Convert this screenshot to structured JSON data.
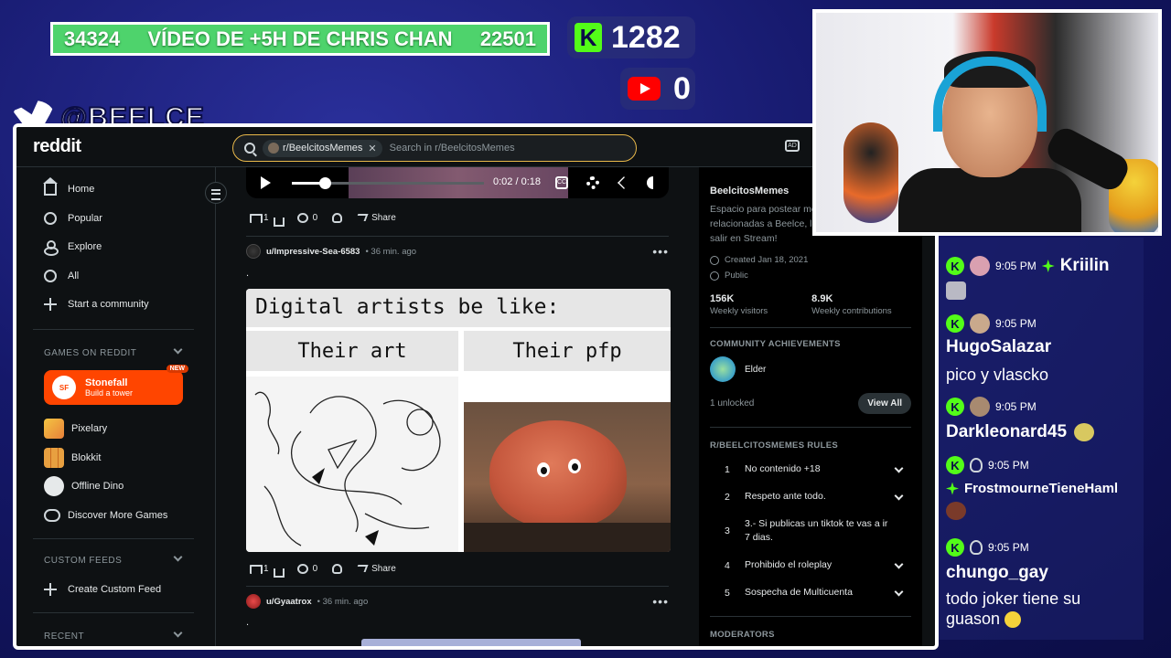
{
  "overlay": {
    "ticker_left": "34324",
    "ticker_message": "VÍDEO DE +5H DE CHRIS CHAN",
    "ticker_right": "22501",
    "kick_count": "1282",
    "kick_letter": "K",
    "youtube_count": "0",
    "twitter_handle": "@BEELCE_"
  },
  "reddit": {
    "logo": "reddit",
    "search": {
      "chip": "r/BeelcitosMemes",
      "placeholder": "Search in r/BeelcitosMemes"
    },
    "ad_label": "AD",
    "sidebar": {
      "nav": [
        {
          "label": "Home",
          "icon": "home-icon"
        },
        {
          "label": "Popular",
          "icon": "popular-icon"
        },
        {
          "label": "Explore",
          "icon": "explore-icon"
        },
        {
          "label": "All",
          "icon": "all-icon"
        },
        {
          "label": "Start a community",
          "icon": "plus-icon"
        }
      ],
      "games_header": "GAMES ON REDDIT",
      "featured_game": {
        "name": "Stonefall",
        "subtitle": "Build a tower",
        "badge": "NEW",
        "logo_text": "SF"
      },
      "games": [
        "Pixelary",
        "Blokkit",
        "Offline Dino",
        "Discover More Games"
      ],
      "custom_feeds_header": "CUSTOM FEEDS",
      "create_feed": "Create Custom Feed",
      "recent_header": "RECENT"
    },
    "player": {
      "time": "0:02 / 0:18",
      "progress": 0.17,
      "cc": "CC"
    },
    "posts": [
      {
        "votes": "1",
        "comments": "0",
        "share": "Share"
      },
      {
        "author": "u/Impressive-Sea-6583",
        "age": "36 min. ago",
        "body": ".",
        "meme_title": "Digital artists be like:",
        "meme_left": "Their art",
        "meme_right": "Their pfp",
        "votes": "1",
        "comments": "0",
        "share": "Share"
      },
      {
        "author": "u/Gyaatrox",
        "age": "36 min. ago",
        "body": "."
      }
    ],
    "rail": {
      "name": "BeelcitosMemes",
      "description": "Espacio para postear me... relacionadas a Beelce, lo... salir en Stream!",
      "desc_lines": [
        "Espacio para postear me",
        "relacionadas a Beelce, lo",
        "salir en Stream!"
      ],
      "created": "Created Jan 18, 2021",
      "visibility": "Public",
      "visitors_value": "156K",
      "visitors_label": "Weekly visitors",
      "contrib_value": "8.9K",
      "contrib_label": "Weekly contributions",
      "achievements_header": "COMMUNITY ACHIEVEMENTS",
      "achievement": "Elder",
      "unlocked": "1 unlocked",
      "view_all": "View All",
      "rules_header": "R/BEELCITOSMEMES RULES",
      "rules": [
        {
          "n": "1",
          "text": "No contenido +18"
        },
        {
          "n": "2",
          "text": "Respeto ante todo."
        },
        {
          "n": "3",
          "text": "3.- Si publicas un tiktok te vas a ir 7 dias."
        },
        {
          "n": "4",
          "text": "Prohibido el roleplay"
        },
        {
          "n": "5",
          "text": "Sospecha de Multicuenta"
        }
      ],
      "moderators_header": "MODERATORS"
    }
  },
  "chat": [
    {
      "time": "9:05 PM",
      "user": "Kriilin",
      "text": ""
    },
    {
      "time": "9:05 PM",
      "user": "HugoSalazar",
      "text": "pico y vlascko"
    },
    {
      "time": "9:05 PM",
      "user": "Darkleonard45",
      "text": ""
    },
    {
      "time": "9:05 PM",
      "user": "FrostmourneTieneHaml",
      "text": ""
    },
    {
      "time": "9:05 PM",
      "user": "chungo_gay",
      "text": "todo joker tiene su guason"
    }
  ],
  "colors": {
    "kick_green": "#53fc18",
    "reddit_orange": "#ff4500",
    "ticker_green": "#4ed36c"
  }
}
